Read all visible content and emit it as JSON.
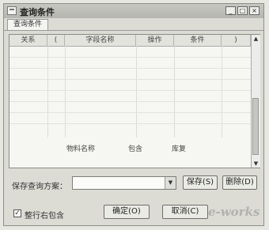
{
  "window": {
    "title": "查询条件",
    "minimize": "_",
    "maximize": "□",
    "close": "×"
  },
  "tab": {
    "label": "查询条件"
  },
  "grid": {
    "columns": [
      "关系",
      "(",
      "字段名称",
      "操作",
      "条件",
      ")"
    ],
    "row": {
      "field": "物料名称",
      "op": "包含",
      "value": "库复"
    }
  },
  "save_scheme": {
    "label": "保存查询方案：",
    "value": ""
  },
  "buttons": {
    "save": "保存(S)",
    "delete": "删除(D)",
    "ok": "确定(O)",
    "cancel": "取消(C)"
  },
  "checkbox": {
    "checked": true,
    "mark": "✓",
    "label": "整行右包含"
  },
  "watermark": "e-works"
}
